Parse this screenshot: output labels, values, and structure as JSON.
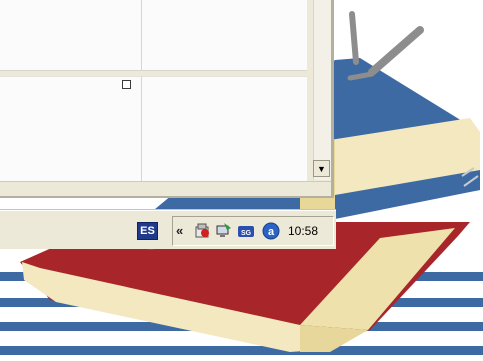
{
  "taskbar": {
    "language": "ES",
    "show_hidden_icons": "«",
    "clock": "10:58",
    "tray_icons": [
      "security-shield-icon",
      "network-computer-icon",
      "game-controller-icon",
      "sg-icon",
      "adobe-update-icon"
    ]
  },
  "window": {
    "scroll_down_glyph": "▼"
  },
  "colors": {
    "book_blue": "#3d6aa3",
    "book_red": "#a8262a",
    "book_pages": "#f3e8bf",
    "stripe_blue": "#3d6aa3"
  }
}
